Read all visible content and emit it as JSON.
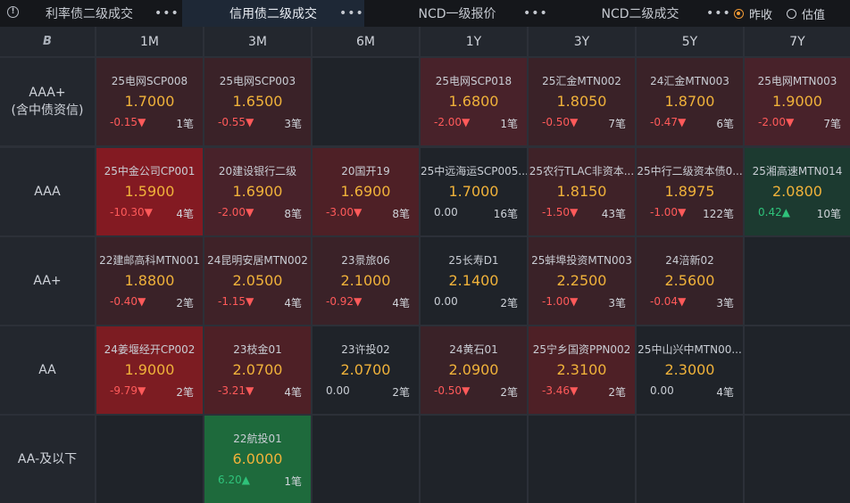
{
  "tabs": [
    {
      "label": "利率债二级成交",
      "active": false
    },
    {
      "label": "信用债二级成交",
      "active": true
    },
    {
      "label": "NCD一级报价",
      "active": false
    },
    {
      "label": "NCD二级成交",
      "active": false
    }
  ],
  "more_label": "•••",
  "options": {
    "prev_close": "昨收",
    "valuation": "估值",
    "selected": "prev_close"
  },
  "corner": "B",
  "columns": [
    "1M",
    "3M",
    "6M",
    "1Y",
    "3Y",
    "5Y",
    "7Y"
  ],
  "rows": [
    {
      "label": [
        "AAA+",
        "(含中债资信)"
      ],
      "cells": [
        {
          "name": "25电网SCP008",
          "price": "1.7000",
          "change": "-0.15",
          "dir": "down",
          "count": "1笔",
          "bg": "#3a2228"
        },
        {
          "name": "25电网SCP003",
          "price": "1.6500",
          "change": "-0.55",
          "dir": "down",
          "count": "3笔",
          "bg": "#3a2228"
        },
        null,
        {
          "name": "25电网SCP018",
          "price": "1.6800",
          "change": "-2.00",
          "dir": "down",
          "count": "1笔",
          "bg": "#48222a"
        },
        {
          "name": "25汇金MTN002",
          "price": "1.8050",
          "change": "-0.50",
          "dir": "down",
          "count": "7笔",
          "bg": "#3a2228"
        },
        {
          "name": "24汇金MTN003",
          "price": "1.8700",
          "change": "-0.47",
          "dir": "down",
          "count": "6笔",
          "bg": "#3a2228"
        },
        {
          "name": "25电网MTN003",
          "price": "1.9000",
          "change": "-2.00",
          "dir": "down",
          "count": "7笔",
          "bg": "#48222a"
        }
      ]
    },
    {
      "label": [
        "AAA"
      ],
      "cells": [
        {
          "name": "25中金公司CP001",
          "price": "1.5900",
          "change": "-10.30",
          "dir": "down",
          "count": "4笔",
          "bg": "#831a22"
        },
        {
          "name": "20建设银行二级",
          "price": "1.6900",
          "change": "-2.00",
          "dir": "down",
          "count": "8笔",
          "bg": "#48222a"
        },
        {
          "name": "20国开19",
          "price": "1.6900",
          "change": "-3.00",
          "dir": "down",
          "count": "8笔",
          "bg": "#4e2026"
        },
        {
          "name": "25中远海运SCP005...",
          "price": "1.7000",
          "change": "0.00",
          "dir": "flat",
          "count": "16笔",
          "bg": "#1f2329"
        },
        {
          "name": "25农行TLAC非资本...",
          "price": "1.8150",
          "change": "-1.50",
          "dir": "down",
          "count": "43笔",
          "bg": "#3f2228"
        },
        {
          "name": "25中行二级资本债0...",
          "price": "1.8975",
          "change": "-1.00",
          "dir": "down",
          "count": "122笔",
          "bg": "#3a2228"
        },
        {
          "name": "25湘高速MTN014",
          "price": "2.0800",
          "change": "0.42",
          "dir": "up",
          "count": "10笔",
          "bg": "#1c3a30"
        }
      ]
    },
    {
      "label": [
        "AA+"
      ],
      "cells": [
        {
          "name": "22建邮高科MTN001",
          "price": "1.8800",
          "change": "-0.40",
          "dir": "down",
          "count": "2笔",
          "bg": "#3a2228"
        },
        {
          "name": "24昆明安居MTN002",
          "price": "2.0500",
          "change": "-1.15",
          "dir": "down",
          "count": "4笔",
          "bg": "#3f2228"
        },
        {
          "name": "23景旅06",
          "price": "2.1000",
          "change": "-0.92",
          "dir": "down",
          "count": "4笔",
          "bg": "#3a2228"
        },
        {
          "name": "25长寿D1",
          "price": "2.1400",
          "change": "0.00",
          "dir": "flat",
          "count": "2笔",
          "bg": "#1f2329"
        },
        {
          "name": "25蚌埠投资MTN003",
          "price": "2.2500",
          "change": "-1.00",
          "dir": "down",
          "count": "3笔",
          "bg": "#3a2228"
        },
        {
          "name": "24涪新02",
          "price": "2.5600",
          "change": "-0.04",
          "dir": "down",
          "count": "3笔",
          "bg": "#352228"
        },
        null
      ]
    },
    {
      "label": [
        "AA"
      ],
      "cells": [
        {
          "name": "24姜堰经开CP002",
          "price": "1.9000",
          "change": "-9.79",
          "dir": "down",
          "count": "2笔",
          "bg": "#7c1c22"
        },
        {
          "name": "23枝金01",
          "price": "2.0700",
          "change": "-3.21",
          "dir": "down",
          "count": "4笔",
          "bg": "#4e2026"
        },
        {
          "name": "23许投02",
          "price": "2.0700",
          "change": "0.00",
          "dir": "flat",
          "count": "2笔",
          "bg": "#1f2329"
        },
        {
          "name": "24黄石01",
          "price": "2.0900",
          "change": "-0.50",
          "dir": "down",
          "count": "2笔",
          "bg": "#3a2228"
        },
        {
          "name": "25宁乡国资PPN002",
          "price": "2.3100",
          "change": "-3.46",
          "dir": "down",
          "count": "2笔",
          "bg": "#4e2026"
        },
        {
          "name": "25中山兴中MTN00...",
          "price": "2.3000",
          "change": "0.00",
          "dir": "flat",
          "count": "4笔",
          "bg": "#1f2329"
        },
        null
      ]
    },
    {
      "label": [
        "AA-及以下"
      ],
      "cells": [
        null,
        {
          "name": "22航投01",
          "price": "6.0000",
          "change": "6.20",
          "dir": "up",
          "count": "1笔",
          "bg": "#1e6a3c"
        },
        null,
        null,
        null,
        null,
        null
      ]
    }
  ],
  "empty_bg": "#1f2329",
  "arrows": {
    "down": "▼",
    "up": "▲"
  }
}
